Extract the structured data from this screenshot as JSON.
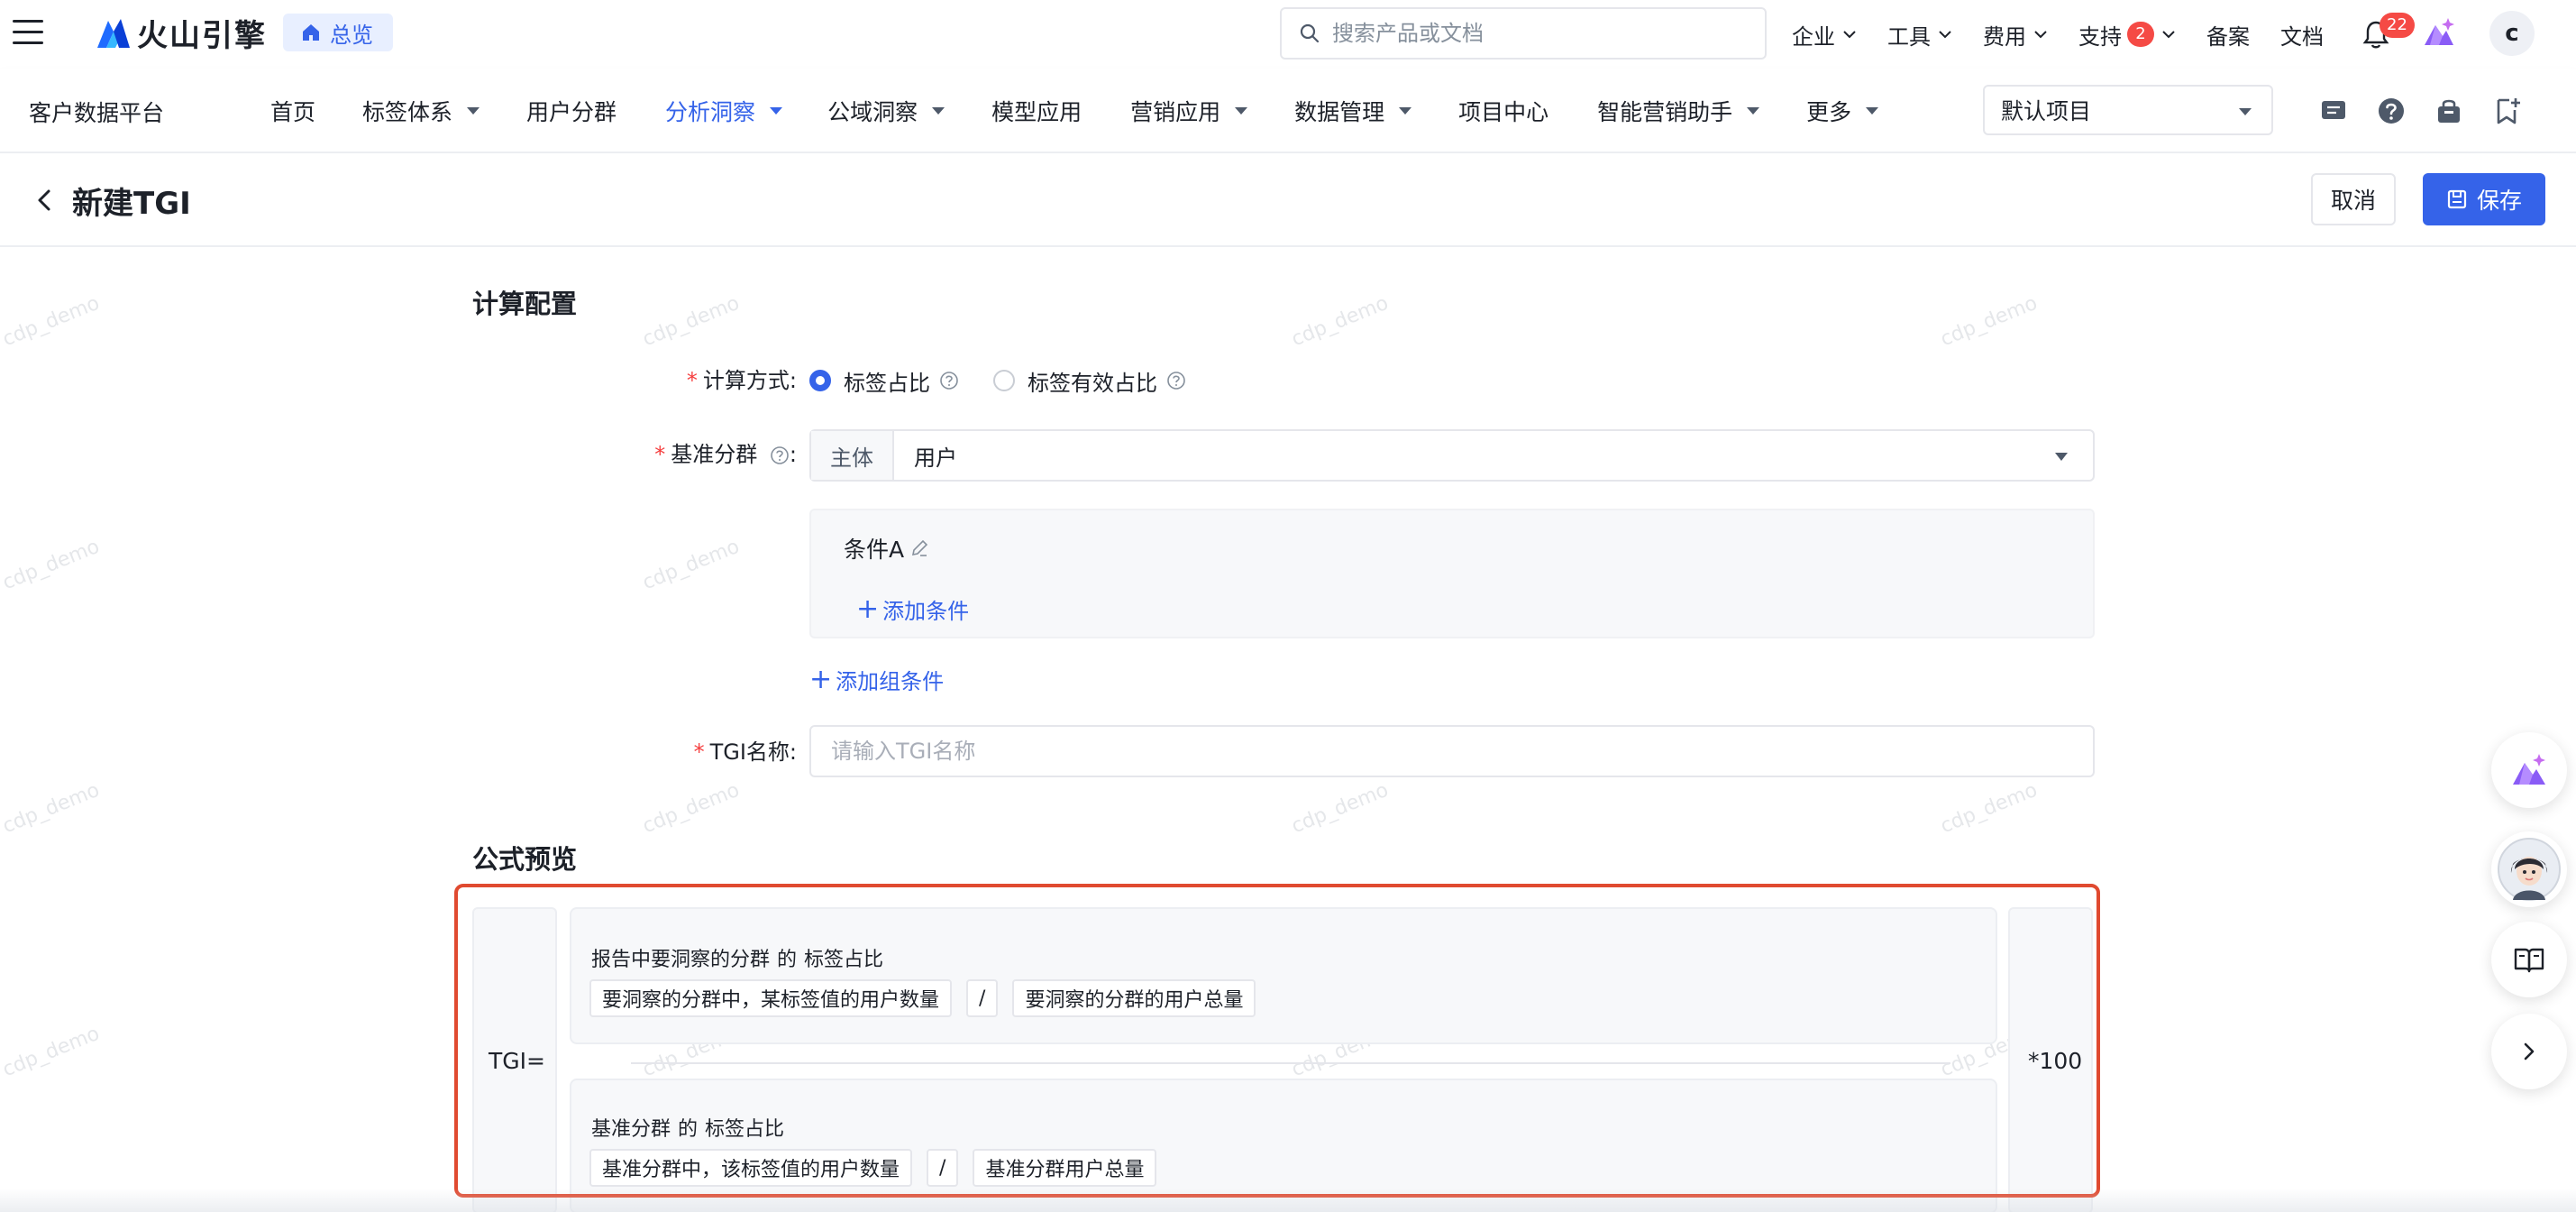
{
  "topbar": {
    "brand": "火山引擎",
    "overview_label": "总览",
    "search_placeholder": "搜索产品或文档",
    "nav": [
      {
        "label": "企业"
      },
      {
        "label": "工具"
      },
      {
        "label": "费用"
      },
      {
        "label": "支持",
        "badge": "2"
      },
      {
        "label": "备案"
      },
      {
        "label": "文档"
      }
    ],
    "notification_count": "22",
    "avatar_letter": "c"
  },
  "subnav": {
    "platform": "客户数据平台",
    "items": [
      {
        "label": "首页",
        "dropdown": false,
        "active": false
      },
      {
        "label": "标签体系",
        "dropdown": true,
        "active": false
      },
      {
        "label": "用户分群",
        "dropdown": false,
        "active": false
      },
      {
        "label": "分析洞察",
        "dropdown": true,
        "active": true
      },
      {
        "label": "公域洞察",
        "dropdown": true,
        "active": false
      },
      {
        "label": "模型应用",
        "dropdown": false,
        "active": false
      },
      {
        "label": "营销应用",
        "dropdown": true,
        "active": false
      },
      {
        "label": "数据管理",
        "dropdown": true,
        "active": false
      },
      {
        "label": "项目中心",
        "dropdown": false,
        "active": false
      },
      {
        "label": "智能营销助手",
        "dropdown": true,
        "active": false
      },
      {
        "label": "更多",
        "dropdown": true,
        "active": false
      }
    ],
    "project": "默认项目"
  },
  "header": {
    "title": "新建TGI",
    "cancel_label": "取消",
    "save_label": "保存"
  },
  "form": {
    "section_title": "计算配置",
    "method_label": "计算方式:",
    "method_options": [
      "标签占比",
      "标签有效占比"
    ],
    "method_selected": 0,
    "base_label": "基准分群",
    "base_colon": ":",
    "subject_prefix": "主体",
    "subject_value": "用户",
    "condition_title": "条件A",
    "add_condition": "添加条件",
    "add_group_condition": "添加组条件",
    "name_label": "TGI名称:",
    "name_value": "",
    "name_placeholder": "请输入TGI名称"
  },
  "formula": {
    "section_title": "公式预览",
    "left": "TGI=",
    "right": "*100",
    "numerator": {
      "heading_a": "报告中要洞察的分群",
      "heading_b": "的",
      "heading_c": "标签占比",
      "chips": [
        "要洞察的分群中，某标签值的用户数量",
        "/",
        "要洞察的分群的用户总量"
      ]
    },
    "denominator": {
      "heading_a": "基准分群",
      "heading_b": "的",
      "heading_c": "标签占比",
      "chips": [
        "基准分群中，该标签值的用户数量",
        "/",
        "基准分群用户总量"
      ]
    }
  },
  "watermark": "cdp_demo",
  "colors": {
    "primary": "#3563e9",
    "danger": "#f54a45",
    "highlight_outline": "#e04a30"
  }
}
